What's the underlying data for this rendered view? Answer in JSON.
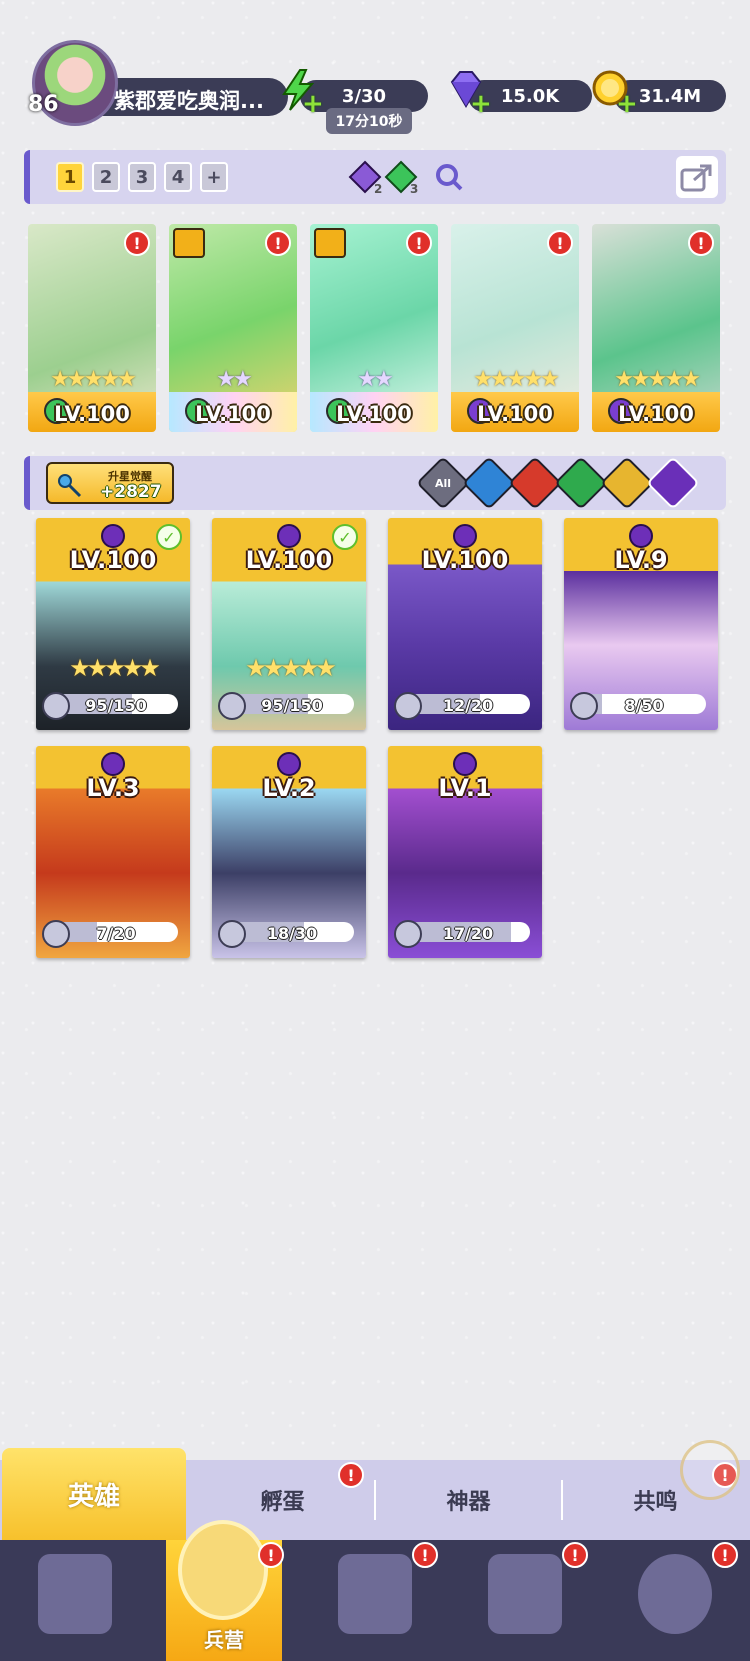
{
  "player": {
    "level": "86",
    "name": "紫郡爱吃奥润..."
  },
  "resources": {
    "energy": "3/30",
    "energy_timer": "17分10秒",
    "gems": "15.0K",
    "gold": "31.4M"
  },
  "teams": {
    "tabs": [
      "1",
      "2",
      "3",
      "4",
      "+"
    ],
    "active_tab": "1",
    "dark_count": "2",
    "nature_count": "3"
  },
  "team_cards": [
    {
      "level": "LV.100",
      "stars": "★★★★★",
      "element": "nature",
      "alert": "!"
    },
    {
      "level": "LV.100",
      "stars": "★★",
      "element": "nature",
      "alert": "!",
      "rank": true
    },
    {
      "level": "LV.100",
      "stars": "★★",
      "element": "nature",
      "alert": "!",
      "rank": true
    },
    {
      "level": "LV.100",
      "stars": "★★★★★",
      "element": "dark",
      "alert": "!"
    },
    {
      "level": "LV.100",
      "stars": "★★★★★",
      "element": "dark",
      "alert": "!"
    }
  ],
  "awaken": {
    "label": "升星觉醒",
    "value": "+2827"
  },
  "filters": [
    "All",
    "water",
    "fire",
    "nature",
    "light",
    "dark"
  ],
  "heroes": [
    {
      "level": "LV.100",
      "progress_text": "95/150",
      "progress": 0.63,
      "stars": "★★★★★",
      "checked": true
    },
    {
      "level": "LV.100",
      "progress_text": "95/150",
      "progress": 0.63,
      "stars": "★★★★★",
      "checked": true
    },
    {
      "level": "LV.100",
      "progress_text": "12/20",
      "progress": 0.6,
      "stars": "",
      "checked": false
    },
    {
      "level": "LV.9",
      "progress_text": "8/50",
      "progress": 0.16,
      "stars": "",
      "checked": false
    },
    {
      "level": "LV.3",
      "progress_text": "7/20",
      "progress": 0.35,
      "stars": "",
      "checked": false
    },
    {
      "level": "LV.2",
      "progress_text": "18/30",
      "progress": 0.6,
      "stars": "",
      "checked": false
    },
    {
      "level": "LV.1",
      "progress_text": "17/20",
      "progress": 0.85,
      "stars": "",
      "checked": false
    }
  ],
  "subtabs": [
    "英雄",
    "孵蛋",
    "神器",
    "共鸣"
  ],
  "subtab_alerts": [
    "",
    "!",
    "",
    "!"
  ],
  "nav": [
    {
      "label": ""
    },
    {
      "label": "兵营"
    },
    {
      "label": ""
    },
    {
      "label": ""
    },
    {
      "label": ""
    }
  ],
  "nav_alerts": [
    "",
    "!",
    "!",
    "!",
    "!"
  ],
  "colors": {
    "accent": "#6a5acd",
    "gold": "#f5b92a",
    "dark_panel": "#3b3c56",
    "alert": "#e0302a"
  }
}
